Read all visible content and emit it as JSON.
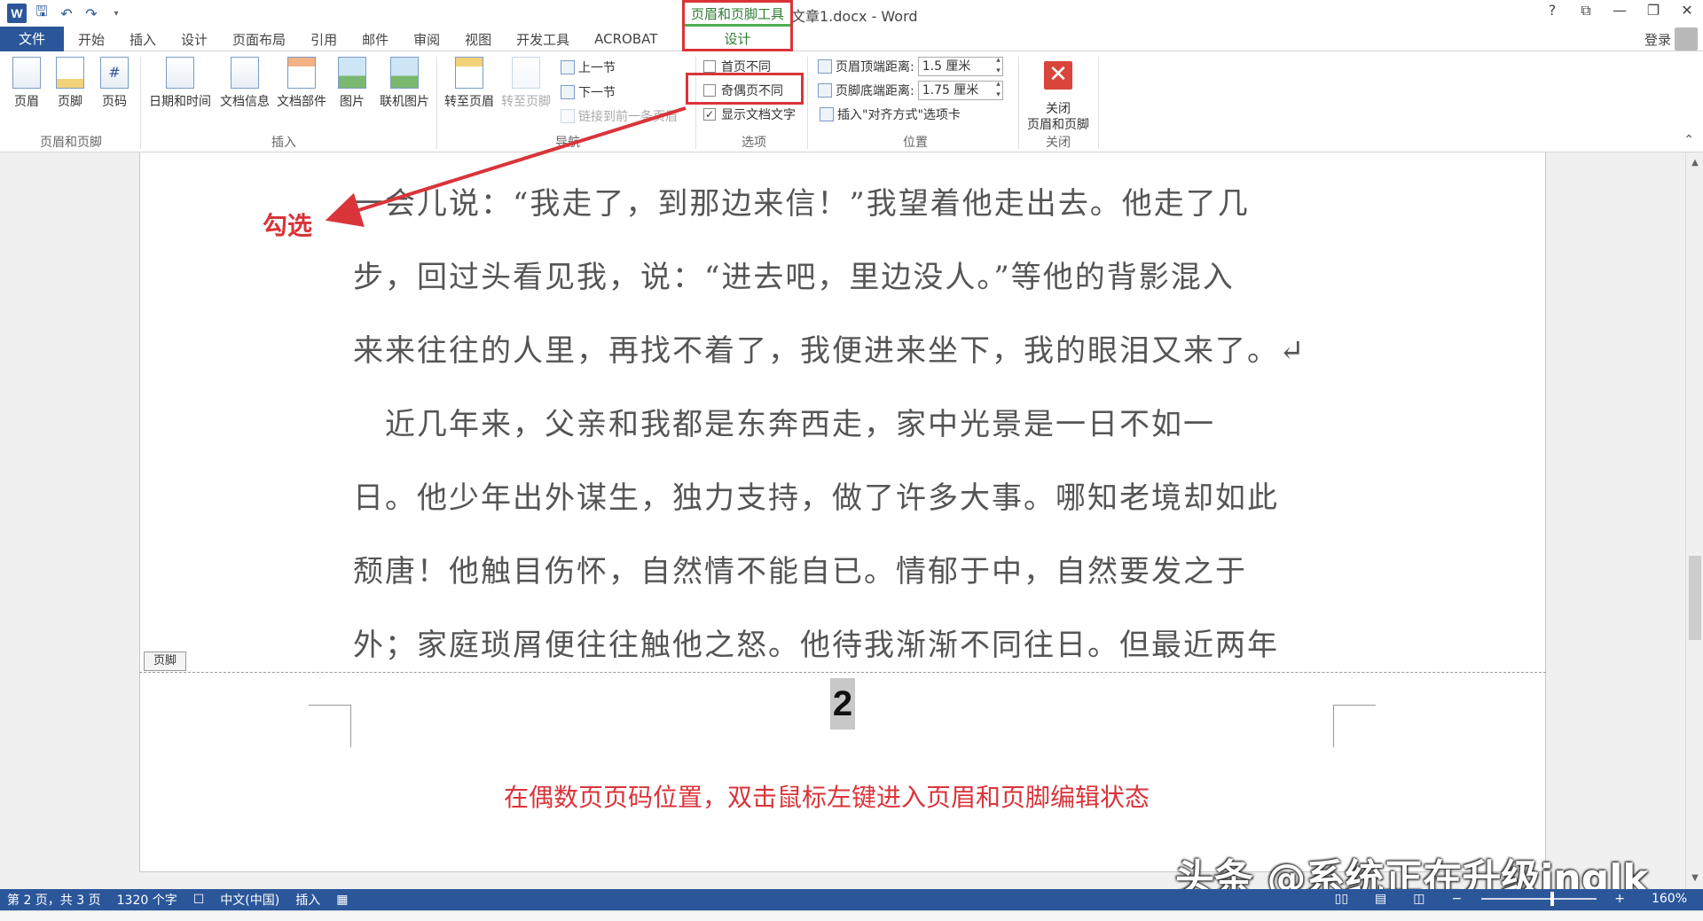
{
  "titlebar": {
    "doc_title": "文章1.docx - Word",
    "app_icon": "W",
    "quick_access": [
      "save-icon",
      "undo-icon",
      "redo-icon",
      "customize-icon"
    ],
    "window_buttons": [
      "?",
      "⧉",
      "—",
      "❐",
      "✕"
    ],
    "context_tools": {
      "header": "页眉和页脚工具",
      "tab": "设计"
    }
  },
  "tabs": {
    "file": "文件",
    "items": [
      "开始",
      "插入",
      "设计",
      "页面布局",
      "引用",
      "邮件",
      "审阅",
      "视图",
      "开发工具",
      "ACROBAT"
    ],
    "login": "登录"
  },
  "ribbon": {
    "header_footer_group": {
      "label": "页眉和页脚",
      "buttons": [
        "页眉",
        "页脚",
        "页码"
      ]
    },
    "insert_group": {
      "label": "插入",
      "buttons": [
        "日期和时间",
        "文档信息",
        "文档部件",
        "图片",
        "联机图片"
      ]
    },
    "navigation_group": {
      "label": "导航",
      "big_buttons": [
        "转至页眉",
        "转至页脚"
      ],
      "small_buttons": [
        "上一节",
        "下一节",
        "链接到前一条页眉"
      ]
    },
    "options_group": {
      "label": "选项",
      "checkboxes": [
        {
          "label": "首页不同",
          "checked": false
        },
        {
          "label": "奇偶页不同",
          "checked": false
        },
        {
          "label": "显示文档文字",
          "checked": true
        }
      ]
    },
    "position_group": {
      "label": "位置",
      "header_top_label": "页眉顶端距离:",
      "header_top_value": "1.5 厘米",
      "footer_bottom_label": "页脚底端距离:",
      "footer_bottom_value": "1.75 厘米",
      "insert_align_tab": "插入\"对齐方式\"选项卡"
    },
    "close_group": {
      "label": "关闭",
      "button_line1": "关闭",
      "button_line2": "页眉和页脚"
    }
  },
  "document": {
    "lines": [
      "一会儿说：“我走了，到那边来信！”我望着他走出去。他走了几",
      "步，回过头看见我，说：“进去吧，里边没人。”等他的背影混入",
      "来来往往的人里，再找不着了，我便进来坐下，我的眼泪又来了。↵",
      "　近几年来，父亲和我都是东奔西走，家中光景是一日不如一",
      "日。他少年出外谋生，独力支持，做了许多大事。哪知老境却如此",
      "颓唐！他触目伤怀，自然情不能自已。情郁于中，自然要发之于",
      "外；家庭琐屑便往往触他之怒。他待我渐渐不同往日。但最近两年"
    ],
    "footer_tag": "页脚",
    "page_number": "2"
  },
  "annotations": {
    "check_label": "勾选",
    "instruction": "在偶数页页码位置，双击鼠标左键进入页眉和页脚编辑状态",
    "color": "#d9343a"
  },
  "watermark": "头条 @系统正在升级inglk",
  "statusbar": {
    "page": "第 2 页，共 3 页",
    "words": "1320 个字",
    "language": "中文(中国)",
    "mode": "插入",
    "zoom": "160%",
    "zoom_fraction": 0.6
  },
  "colors": {
    "accent": "#2b579a",
    "tools_green": "#2e7d32",
    "highlight_red": "#d9343a"
  }
}
